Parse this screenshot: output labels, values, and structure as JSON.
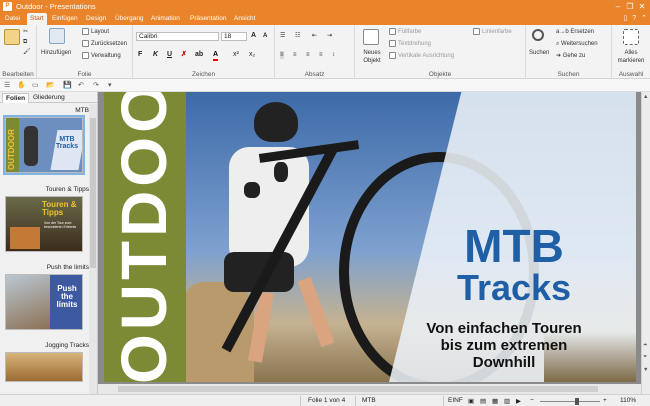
{
  "window": {
    "title": "Outdoor - Presentations",
    "app_letter": "P"
  },
  "menu_tabs": [
    "Datei",
    "Start",
    "Einfügen",
    "Design",
    "Übergang",
    "Animation",
    "Präsentation",
    "Ansicht"
  ],
  "active_tab": "Start",
  "ribbon": {
    "groups": {
      "edit": "Bearbeiten",
      "folie": "Folie",
      "zeichen": "Zeichen",
      "absatz": "Absatz",
      "objekte": "Objekte",
      "suchen": "Suchen",
      "auswahl": "Auswahl"
    },
    "folie": {
      "hinzufuegen": "Hinzufügen",
      "layout": "Layout",
      "zuruecksetzen": "Zurücksetzen",
      "verwaltung": "Verwaltung"
    },
    "zeichen": {
      "font": "Calibri",
      "size": "18"
    },
    "objekte": {
      "neues_objekt": "Neues Objekt",
      "fuellfarbe": "Füllfarbe",
      "textdrehung": "Textdrehung",
      "vertikale_ausrichtung": "Vertikale Ausrichtung",
      "linienfarbe": "Linienfarbe"
    },
    "suchen": {
      "suchen": "Suchen",
      "ersetzen": "Ersetzen",
      "weitersuchen": "Weitersuchen",
      "gehe_zu": "Gehe zu"
    },
    "auswahl": {
      "alles_markieren": "Alles markieren"
    }
  },
  "panel": {
    "tabs": [
      "Folien",
      "Gliederung"
    ],
    "slides": [
      {
        "label": "MTB",
        "thumb_title": "OUTDOOR",
        "thumb_sub": "MTB Tracks"
      },
      {
        "label": "Touren & Tipps",
        "thumb_title": "Touren & Tipps",
        "thumb_sub": "Von der Tour zum besonderen Erlebnis"
      },
      {
        "label": "Push the limits",
        "thumb_title": "Push the limits",
        "thumb_sub": ""
      },
      {
        "label": "Jogging Tracks",
        "thumb_title": "",
        "thumb_sub": ""
      }
    ]
  },
  "slide": {
    "side_title": "OUTDOOR",
    "title_line1": "MTB",
    "title_line2": "Tracks",
    "subtitle_line1": "Von einfachen Touren",
    "subtitle_line2": "bis zum extremen",
    "subtitle_line3": "Downhill"
  },
  "status": {
    "slide_counter": "Folie 1 von 4",
    "layout_name": "MTB",
    "mode": "EINF",
    "zoom": "110%"
  },
  "colors": {
    "accent": "#e9842a",
    "slide_blue": "#1f5fa6",
    "olive": "#7d8a35"
  }
}
